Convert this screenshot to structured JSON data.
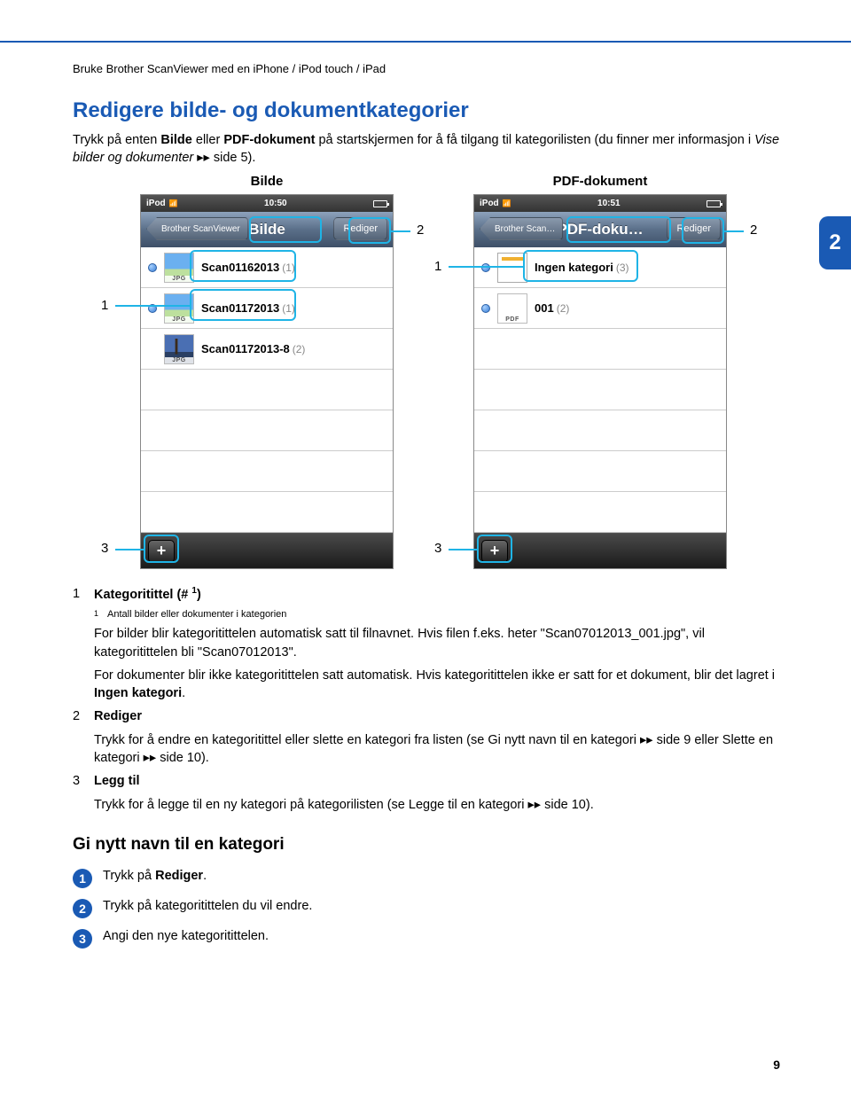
{
  "breadcrumb": "Bruke Brother ScanViewer med en iPhone / iPod touch / iPad",
  "heading": "Redigere bilde- og dokumentkategorier",
  "intro_parts": {
    "p1": "Trykk på enten ",
    "p2": "Bilde",
    "p3": " eller ",
    "p4": "PDF-dokument",
    "p5": " på startskjermen for å få tilgang til kategorilisten (du finner mer informasjon i ",
    "p6": "Vise bilder og dokumenter",
    "p7": " ",
    "arrow": "▸▸",
    "p8": " side 5)."
  },
  "side_tab": "2",
  "screens": {
    "left": {
      "header": "Bilde",
      "status_device": "iPod",
      "status_time": "10:50",
      "back_label": "Brother ScanViewer",
      "title": "Bilde",
      "edit_label": "Rediger",
      "rows": [
        {
          "thumb": "sky",
          "ext": "JPG",
          "name": "Scan01162013",
          "count": "(1)"
        },
        {
          "thumb": "sky",
          "ext": "JPG",
          "name": "Scan01172013",
          "count": "(1)"
        },
        {
          "thumb": "wind",
          "ext": "JPG",
          "name": "Scan01172013-8",
          "count": "(2)"
        }
      ]
    },
    "right": {
      "header": "PDF-dokument",
      "status_device": "iPod",
      "status_time": "10:51",
      "back_label": "Brother Scan…",
      "title": "PDF-doku…",
      "edit_label": "Rediger",
      "rows": [
        {
          "thumb": "doc",
          "ext": "",
          "name": "Ingen kategori",
          "count": "(3)"
        },
        {
          "thumb": "pdf",
          "ext": "PDF",
          "name": "001",
          "count": "(2)"
        }
      ]
    }
  },
  "callouts": {
    "one": "1",
    "two": "2",
    "three": "3"
  },
  "legend": {
    "item1": {
      "num": "1",
      "title_a": "Kategoritittel (# ",
      "title_b": ")",
      "sup": "1",
      "footnote_num": "1",
      "footnote": "Antall bilder eller dokumenter i kategorien",
      "para1": "For bilder blir kategoritittelen automatisk satt til filnavnet. Hvis filen f.eks. heter \"Scan07012013_001.jpg\", vil kategoritittelen bli \"Scan07012013\".",
      "para2a": "For dokumenter blir ikke kategoritittelen satt automatisk. Hvis kategoritittelen ikke er satt for et dokument, blir det lagret i ",
      "para2b": "Ingen kategori",
      "para2c": "."
    },
    "item2": {
      "num": "2",
      "title": "Rediger",
      "para_a": "Trykk for å endre en kategoritittel eller slette en kategori fra listen (se ",
      "para_b": "Gi nytt navn til en kategori",
      "para_c": " ",
      "para_d": " side 9 eller ",
      "para_e": "Slette en kategori",
      "para_f": " ",
      "para_g": " side 10)."
    },
    "item3": {
      "num": "3",
      "title": "Legg til",
      "para_a": "Trykk for å legge til en ny kategori på kategorilisten (se ",
      "para_b": "Legge til en kategori",
      "para_c": " ",
      "para_d": " side 10)."
    }
  },
  "subheading": "Gi nytt navn til en kategori",
  "steps": {
    "s1a": "Trykk på ",
    "s1b": "Rediger",
    "s1c": ".",
    "s2": "Trykk på kategoritittelen du vil endre.",
    "s3": "Angi den nye kategoritittelen."
  },
  "page_number": "9"
}
